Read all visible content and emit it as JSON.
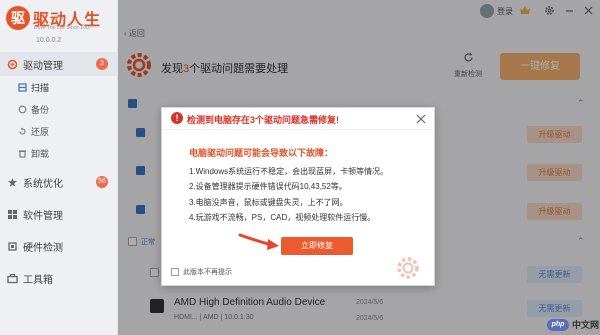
{
  "app": {
    "logo_char": "驱",
    "name": "驱动人生",
    "slogan": "Drive The Life  Since 2007",
    "version": "10.0.0.2"
  },
  "titlebar": {
    "login_label": "登录",
    "icons": [
      "crown-icon",
      "settings-icon",
      "minimize-icon",
      "close-icon"
    ]
  },
  "sidebar": {
    "items": [
      {
        "label": "驱动管理",
        "icon": "driver-icon",
        "badge": "3",
        "active": true
      },
      {
        "label": "系统优化",
        "icon": "optimize-icon",
        "badge": "56"
      },
      {
        "label": "软件管理",
        "icon": "software-icon"
      },
      {
        "label": "硬件检测",
        "icon": "hardware-icon"
      },
      {
        "label": "工具箱",
        "icon": "toolbox-icon"
      }
    ],
    "subitems": [
      {
        "label": "扫描",
        "icon": "scan-icon"
      },
      {
        "label": "备份",
        "icon": "backup-icon"
      },
      {
        "label": "还原",
        "icon": "restore-icon"
      },
      {
        "label": "卸载",
        "icon": "uninstall-icon"
      }
    ]
  },
  "main": {
    "back_label": "返回",
    "headline_prefix": "发现",
    "headline_count": "3",
    "headline_suffix": "个驱动问题需要处理",
    "rescan_label": "重新检测",
    "fixall_label": "一键修复",
    "section_normal": "正常",
    "device": {
      "name": "AMD High Definition Audio Device",
      "meta": "HDMI...   |   AMD   |   10.0.1.30",
      "date1": "2024/5/6",
      "date2": "2024/5/6"
    },
    "row_buttons": {
      "upgrade": "升级驱动",
      "no_update": "无需更新"
    },
    "colors": {
      "accent": "#e8542a",
      "fix_button": "#ec5a2f",
      "blue": "#3b73c6"
    }
  },
  "dialog": {
    "title": "检测到电脑存在3个驱动问题急需修复!",
    "reason_title": "电脑驱动问题可能会导致以下故障：",
    "reasons": [
      "1.Windows系统运行不稳定，会出现蓝屏，卡顿等情况。",
      "2.设备管理器提示硬件错误代码10,43,52等。",
      "3.电脑没声音，鼠标或键盘失灵，上不了网。",
      "4.玩游戏不流畅，PS，CAD，视频处理软件运行慢。"
    ],
    "fix_label": "立即修复",
    "no_more_label": "此版本不再提示"
  },
  "watermark": {
    "logo": "php",
    "text": "中文网"
  }
}
